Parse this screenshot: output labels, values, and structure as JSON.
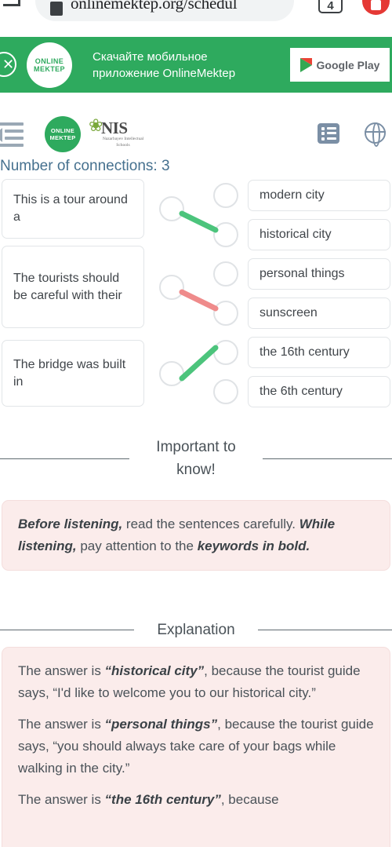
{
  "browser": {
    "url": "onlinemektep.org/schedul",
    "tab_count": "4",
    "back_icon": "back-arrow-icon",
    "page_icon": "page-icon",
    "record_icon": "record-upload-icon"
  },
  "promo_banner": {
    "close_icon": "close-icon",
    "logo_line1": "ONLINE",
    "logo_line2": "MEKTEP",
    "text_line1": "Скачайте мобильное",
    "text_line2": "приложение OnlineMektep",
    "store_button": "Google Play",
    "store_icon": "google-play-icon",
    "background_color": "#2eaa5e"
  },
  "site_header": {
    "menu_icon": "collapse-menu-icon",
    "om_logo_line1": "ONLINE",
    "om_logo_line2": "MEKTEP",
    "nis_name": "NIS",
    "nis_subtitle": "Nazarbayev Intellectual Schools",
    "list_icon": "list-view-icon",
    "globe_icon": "language-globe-icon"
  },
  "task": {
    "title": "Number of connections: 3",
    "prompts": [
      "This is a tour around a",
      "The tourists should be careful with their",
      "The bridge was built in"
    ],
    "options": [
      "modern city",
      "historical city",
      "personal things",
      "sunscreen",
      "the 16th century",
      "the 6th century"
    ],
    "connections": [
      {
        "from": 0,
        "to": 1,
        "color": "#4cc47c",
        "status": "correct"
      },
      {
        "from": 1,
        "to": 3,
        "color": "#ef8b8b",
        "status": "incorrect"
      },
      {
        "from": 2,
        "to": 4,
        "color": "#4cc47c",
        "status": "correct"
      }
    ],
    "annotation_stroke_color": "#3d9be0"
  },
  "important": {
    "heading_line1": "Important to",
    "heading_line2": "know!",
    "body": [
      {
        "bold": "Before listening,",
        "text": " read the sentences carefully. "
      },
      {
        "bold": "While listening,",
        "text": " pay attention to the "
      },
      {
        "bold": "keywords in bold.",
        "text": ""
      }
    ]
  },
  "explanation": {
    "heading": "Explanation",
    "paragraphs": [
      {
        "lead": "The answer is ",
        "answer": "“historical city”",
        "rest": ", because the tourist guide says, “I'd like to welcome you to our historical city.”"
      },
      {
        "lead": "The answer is ",
        "answer": "“personal things”",
        "rest": ", because the tourist guide says, “you should always take care of your bags while walking in the city.”"
      },
      {
        "lead": "The answer is ",
        "answer": "“the 16th century”",
        "rest": ", because"
      }
    ]
  }
}
